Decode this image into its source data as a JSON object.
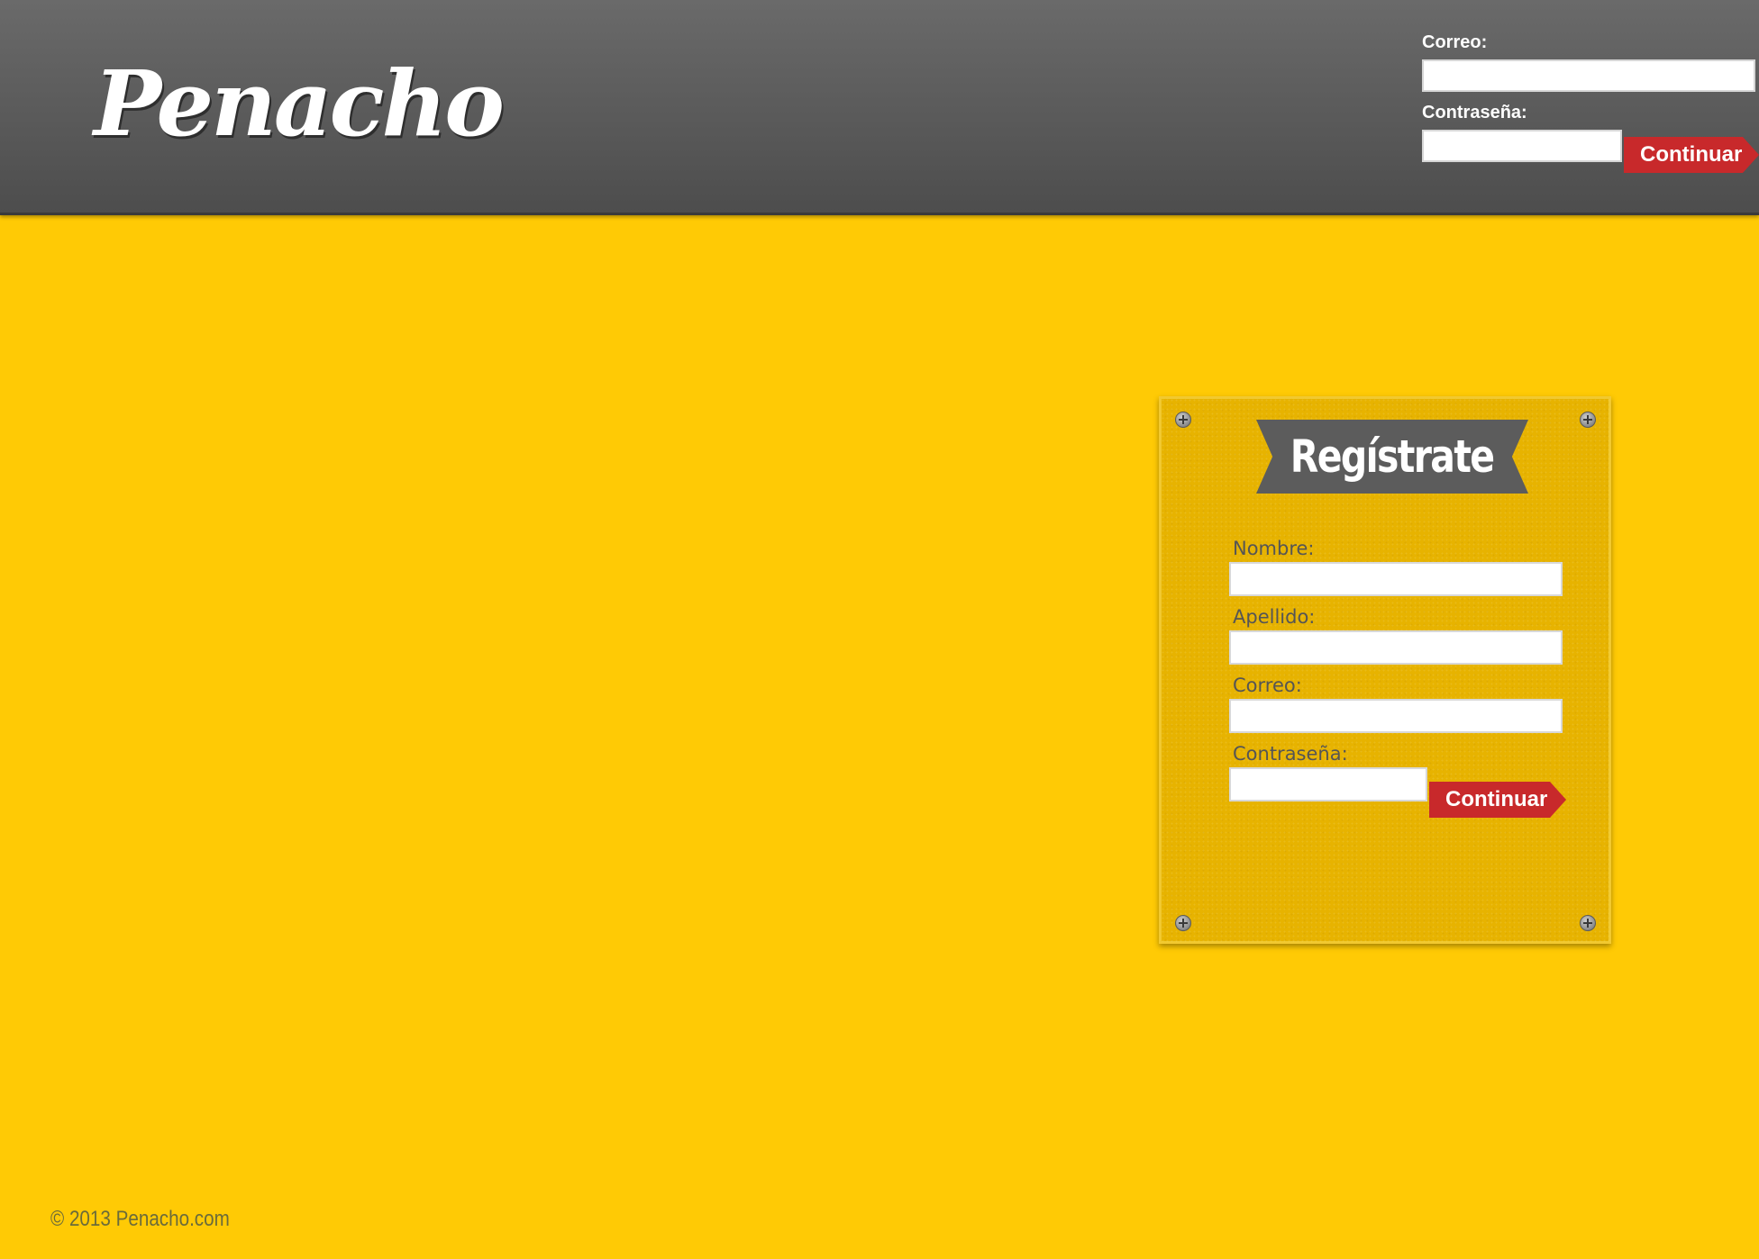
{
  "header": {
    "logo_text": "Penacho",
    "login": {
      "email_label": "Correo:",
      "email_value": "",
      "password_label": "Contraseña:",
      "password_value": "",
      "submit_label": "Continuar"
    }
  },
  "register": {
    "title": "Regístrate",
    "first_name_label": "Nombre:",
    "first_name_value": "",
    "last_name_label": "Apellido:",
    "last_name_value": "",
    "email_label": "Correo:",
    "email_value": "",
    "password_label": "Contraseña:",
    "password_value": "",
    "submit_label": "Continuar"
  },
  "footer": {
    "copyright": "© 2013 Penacho.com"
  },
  "colors": {
    "background": "#ffca05",
    "header": "#5a5a5a",
    "card": "#e7b300",
    "button": "#c8292b",
    "banner": "#5c5c5c"
  }
}
